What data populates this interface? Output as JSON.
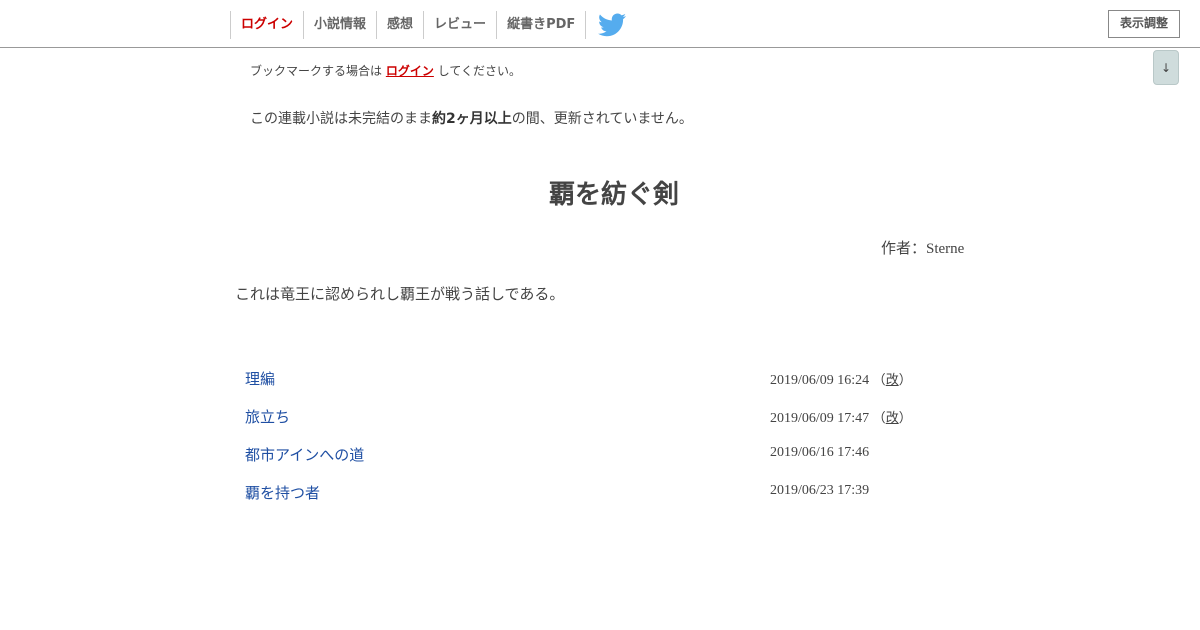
{
  "header": {
    "nav": [
      {
        "label": "ログイン",
        "type": "login"
      },
      {
        "label": "小説情報",
        "type": "link"
      },
      {
        "label": "感想",
        "type": "link"
      },
      {
        "label": "レビュー",
        "type": "link"
      },
      {
        "label": "縦書きPDF",
        "type": "link"
      }
    ],
    "twitter_icon": "twitter-bird-icon",
    "display_settings_label": "表示調整",
    "scroll_down_label": "↓"
  },
  "bookmark": {
    "prefix": "ブックマークする場合は",
    "login_link": "ログイン",
    "suffix": "してください。"
  },
  "notice": {
    "prefix": "この連載小説は未完結のまま",
    "emphasis": "約2ヶ月以上",
    "suffix": "の間、更新されていません。"
  },
  "novel": {
    "title": "覇を紡ぐ剣",
    "author_label": "作者：",
    "author_name": "Sterne",
    "summary": "これは竜王に認められし覇王が戦う話しである。"
  },
  "episodes": [
    {
      "title": "理編",
      "date": "2019/06/09 16:24",
      "revised_label": "改"
    },
    {
      "title": "旅立ち",
      "date": "2019/06/09 17:47",
      "revised_label": "改"
    },
    {
      "title": "都市アインへの道",
      "date": "2019/06/16 17:46",
      "revised_label": ""
    },
    {
      "title": "覇を持つ者",
      "date": "2019/06/23 17:39",
      "revised_label": ""
    }
  ],
  "colors": {
    "login_red": "#cc0000",
    "link_blue": "#1f4fa3",
    "twitter_blue": "#55acee",
    "text": "#444444"
  }
}
